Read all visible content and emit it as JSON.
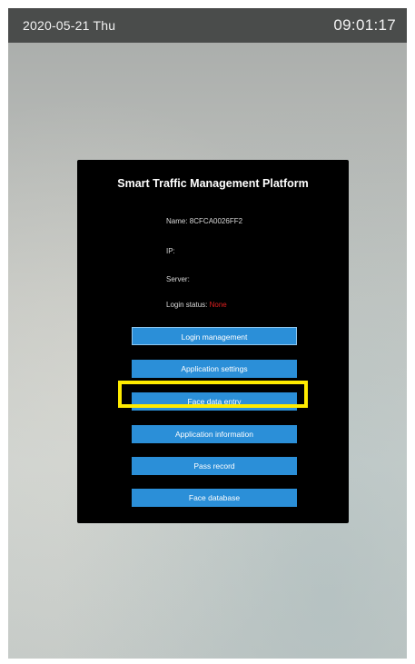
{
  "status_bar": {
    "date": "2020-05-21 Thu",
    "time": "09:01:17"
  },
  "dialog": {
    "title": "Smart Traffic Management Platform",
    "name_label": "Name: ",
    "name_value": "8CFCA0026FF2",
    "ip_label": "IP:",
    "ip_value": "",
    "server_label": "Server:",
    "server_value": "",
    "login_status_label": "Login status: ",
    "login_status_value": "None"
  },
  "menu": {
    "login_management": "Login management",
    "application_settings": "Application settings",
    "face_data_entry": "Face data entry",
    "application_information": "Application information",
    "pass_record": "Pass record",
    "face_database": "Face database"
  },
  "colors": {
    "button": "#2b8fd8",
    "highlight": "#ffeb00",
    "status_value": "#e02020",
    "status_bar": "#4a4c4b"
  }
}
